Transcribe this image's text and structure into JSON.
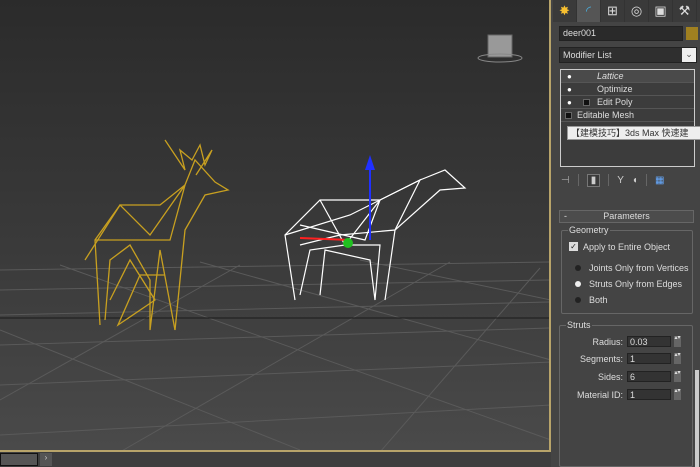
{
  "command_panel": {
    "tabs": [
      "create-icon",
      "modify-icon",
      "hierarchy-icon",
      "motion-icon",
      "display-icon",
      "utilities-icon"
    ],
    "object_name": "deer001",
    "object_color": "#a08020",
    "modifier_list_label": "Modifier List",
    "stack": [
      {
        "label": "Lattice"
      },
      {
        "label": "Optimize"
      },
      {
        "label": "Edit Poly"
      },
      {
        "label": "Editable Mesh"
      }
    ],
    "tooltip": "【建模技巧】3ds Max 快速建"
  },
  "parameters": {
    "title": "Parameters",
    "geometry_label": "Geometry",
    "apply_entire": "Apply to Entire Object",
    "apply_checked": true,
    "options": [
      "Joints Only from Vertices",
      "Struts Only from Edges",
      "Both"
    ],
    "selected_option": 1,
    "struts_label": "Struts",
    "fields": [
      {
        "label": "Radius:",
        "value": "0.03"
      },
      {
        "label": "Segments:",
        "value": "1"
      },
      {
        "label": "Sides:",
        "value": "6"
      },
      {
        "label": "Material ID:",
        "value": "1"
      }
    ]
  }
}
